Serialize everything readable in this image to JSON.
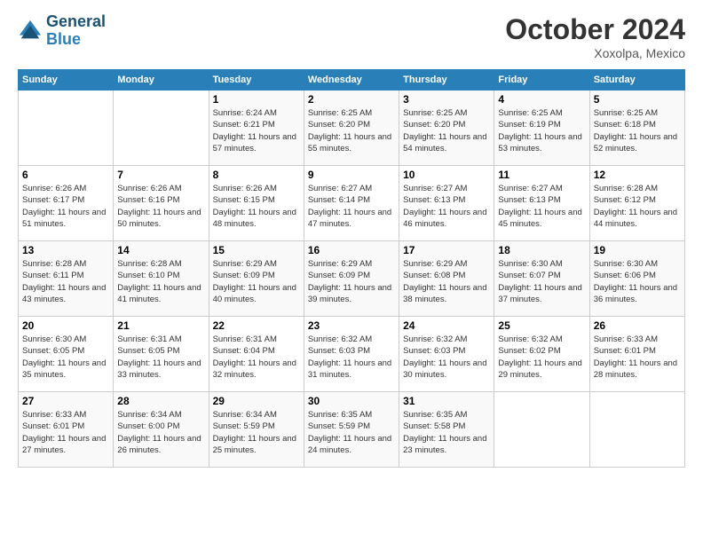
{
  "header": {
    "logo_line1": "General",
    "logo_line2": "Blue",
    "month": "October 2024",
    "location": "Xoxolpa, Mexico"
  },
  "days_of_week": [
    "Sunday",
    "Monday",
    "Tuesday",
    "Wednesday",
    "Thursday",
    "Friday",
    "Saturday"
  ],
  "weeks": [
    [
      {
        "day": "",
        "detail": ""
      },
      {
        "day": "",
        "detail": ""
      },
      {
        "day": "1",
        "detail": "Sunrise: 6:24 AM\nSunset: 6:21 PM\nDaylight: 11 hours and 57 minutes."
      },
      {
        "day": "2",
        "detail": "Sunrise: 6:25 AM\nSunset: 6:20 PM\nDaylight: 11 hours and 55 minutes."
      },
      {
        "day": "3",
        "detail": "Sunrise: 6:25 AM\nSunset: 6:20 PM\nDaylight: 11 hours and 54 minutes."
      },
      {
        "day": "4",
        "detail": "Sunrise: 6:25 AM\nSunset: 6:19 PM\nDaylight: 11 hours and 53 minutes."
      },
      {
        "day": "5",
        "detail": "Sunrise: 6:25 AM\nSunset: 6:18 PM\nDaylight: 11 hours and 52 minutes."
      }
    ],
    [
      {
        "day": "6",
        "detail": "Sunrise: 6:26 AM\nSunset: 6:17 PM\nDaylight: 11 hours and 51 minutes."
      },
      {
        "day": "7",
        "detail": "Sunrise: 6:26 AM\nSunset: 6:16 PM\nDaylight: 11 hours and 50 minutes."
      },
      {
        "day": "8",
        "detail": "Sunrise: 6:26 AM\nSunset: 6:15 PM\nDaylight: 11 hours and 48 minutes."
      },
      {
        "day": "9",
        "detail": "Sunrise: 6:27 AM\nSunset: 6:14 PM\nDaylight: 11 hours and 47 minutes."
      },
      {
        "day": "10",
        "detail": "Sunrise: 6:27 AM\nSunset: 6:13 PM\nDaylight: 11 hours and 46 minutes."
      },
      {
        "day": "11",
        "detail": "Sunrise: 6:27 AM\nSunset: 6:13 PM\nDaylight: 11 hours and 45 minutes."
      },
      {
        "day": "12",
        "detail": "Sunrise: 6:28 AM\nSunset: 6:12 PM\nDaylight: 11 hours and 44 minutes."
      }
    ],
    [
      {
        "day": "13",
        "detail": "Sunrise: 6:28 AM\nSunset: 6:11 PM\nDaylight: 11 hours and 43 minutes."
      },
      {
        "day": "14",
        "detail": "Sunrise: 6:28 AM\nSunset: 6:10 PM\nDaylight: 11 hours and 41 minutes."
      },
      {
        "day": "15",
        "detail": "Sunrise: 6:29 AM\nSunset: 6:09 PM\nDaylight: 11 hours and 40 minutes."
      },
      {
        "day": "16",
        "detail": "Sunrise: 6:29 AM\nSunset: 6:09 PM\nDaylight: 11 hours and 39 minutes."
      },
      {
        "day": "17",
        "detail": "Sunrise: 6:29 AM\nSunset: 6:08 PM\nDaylight: 11 hours and 38 minutes."
      },
      {
        "day": "18",
        "detail": "Sunrise: 6:30 AM\nSunset: 6:07 PM\nDaylight: 11 hours and 37 minutes."
      },
      {
        "day": "19",
        "detail": "Sunrise: 6:30 AM\nSunset: 6:06 PM\nDaylight: 11 hours and 36 minutes."
      }
    ],
    [
      {
        "day": "20",
        "detail": "Sunrise: 6:30 AM\nSunset: 6:05 PM\nDaylight: 11 hours and 35 minutes."
      },
      {
        "day": "21",
        "detail": "Sunrise: 6:31 AM\nSunset: 6:05 PM\nDaylight: 11 hours and 33 minutes."
      },
      {
        "day": "22",
        "detail": "Sunrise: 6:31 AM\nSunset: 6:04 PM\nDaylight: 11 hours and 32 minutes."
      },
      {
        "day": "23",
        "detail": "Sunrise: 6:32 AM\nSunset: 6:03 PM\nDaylight: 11 hours and 31 minutes."
      },
      {
        "day": "24",
        "detail": "Sunrise: 6:32 AM\nSunset: 6:03 PM\nDaylight: 11 hours and 30 minutes."
      },
      {
        "day": "25",
        "detail": "Sunrise: 6:32 AM\nSunset: 6:02 PM\nDaylight: 11 hours and 29 minutes."
      },
      {
        "day": "26",
        "detail": "Sunrise: 6:33 AM\nSunset: 6:01 PM\nDaylight: 11 hours and 28 minutes."
      }
    ],
    [
      {
        "day": "27",
        "detail": "Sunrise: 6:33 AM\nSunset: 6:01 PM\nDaylight: 11 hours and 27 minutes."
      },
      {
        "day": "28",
        "detail": "Sunrise: 6:34 AM\nSunset: 6:00 PM\nDaylight: 11 hours and 26 minutes."
      },
      {
        "day": "29",
        "detail": "Sunrise: 6:34 AM\nSunset: 5:59 PM\nDaylight: 11 hours and 25 minutes."
      },
      {
        "day": "30",
        "detail": "Sunrise: 6:35 AM\nSunset: 5:59 PM\nDaylight: 11 hours and 24 minutes."
      },
      {
        "day": "31",
        "detail": "Sunrise: 6:35 AM\nSunset: 5:58 PM\nDaylight: 11 hours and 23 minutes."
      },
      {
        "day": "",
        "detail": ""
      },
      {
        "day": "",
        "detail": ""
      }
    ]
  ]
}
